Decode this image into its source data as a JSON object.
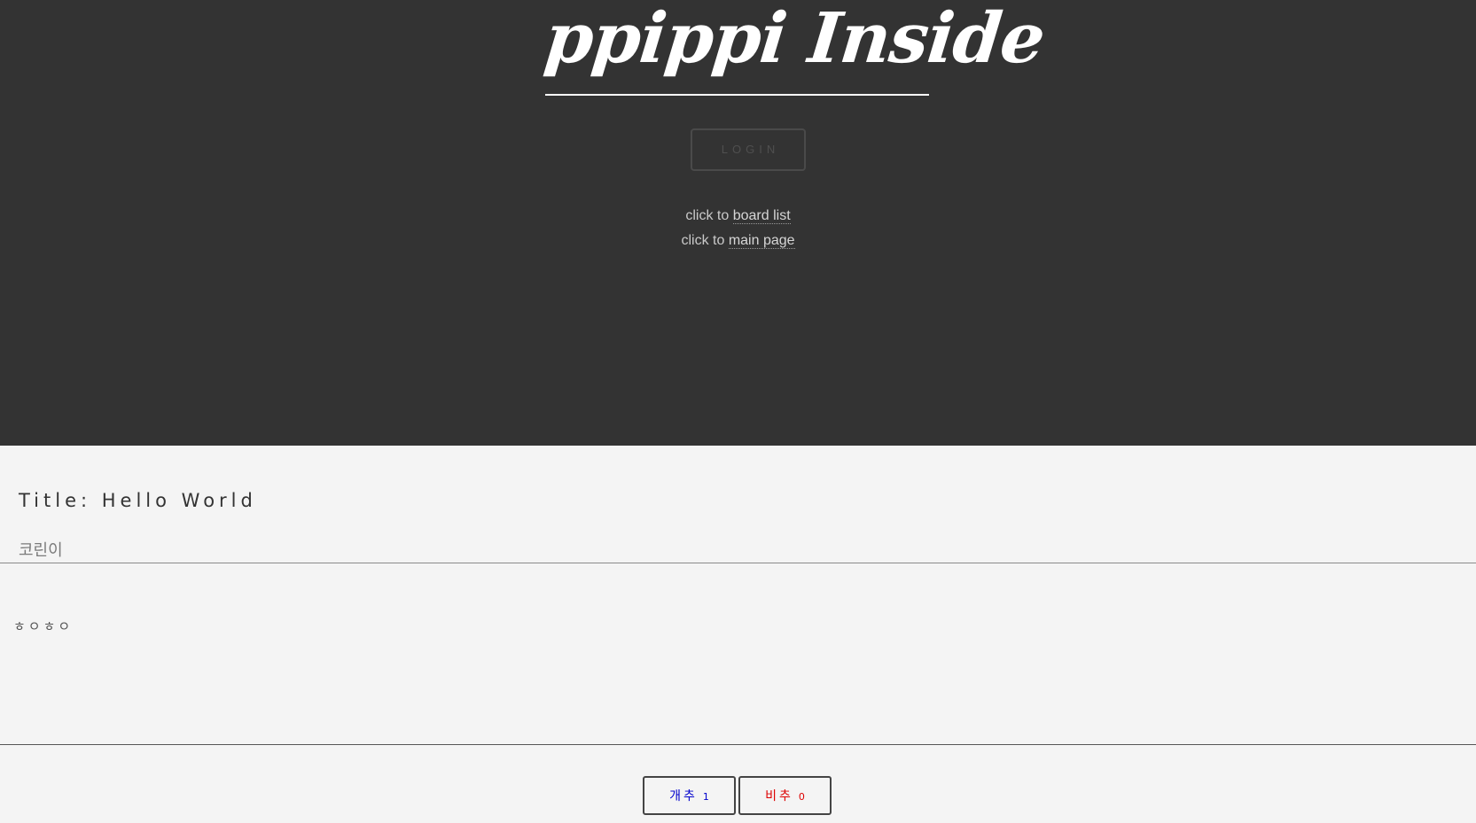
{
  "header": {
    "logo": "ppippi Inside",
    "login_label": "LOGIN",
    "nav": [
      {
        "prefix": "click to",
        "link": "board list"
      },
      {
        "prefix": "click to",
        "link": "main page"
      }
    ]
  },
  "post": {
    "title": "Title: Hello World",
    "author": "코린이",
    "body": "ㅎㅇㅎㅇ"
  },
  "votes": {
    "up": {
      "label": "개추",
      "count": "1"
    },
    "down": {
      "label": "비추",
      "count": "0"
    }
  },
  "colors": {
    "header_bg": "#333333",
    "page_bg": "#f4f4f4",
    "upvote": "#0000cc",
    "downvote": "#dd0000"
  }
}
